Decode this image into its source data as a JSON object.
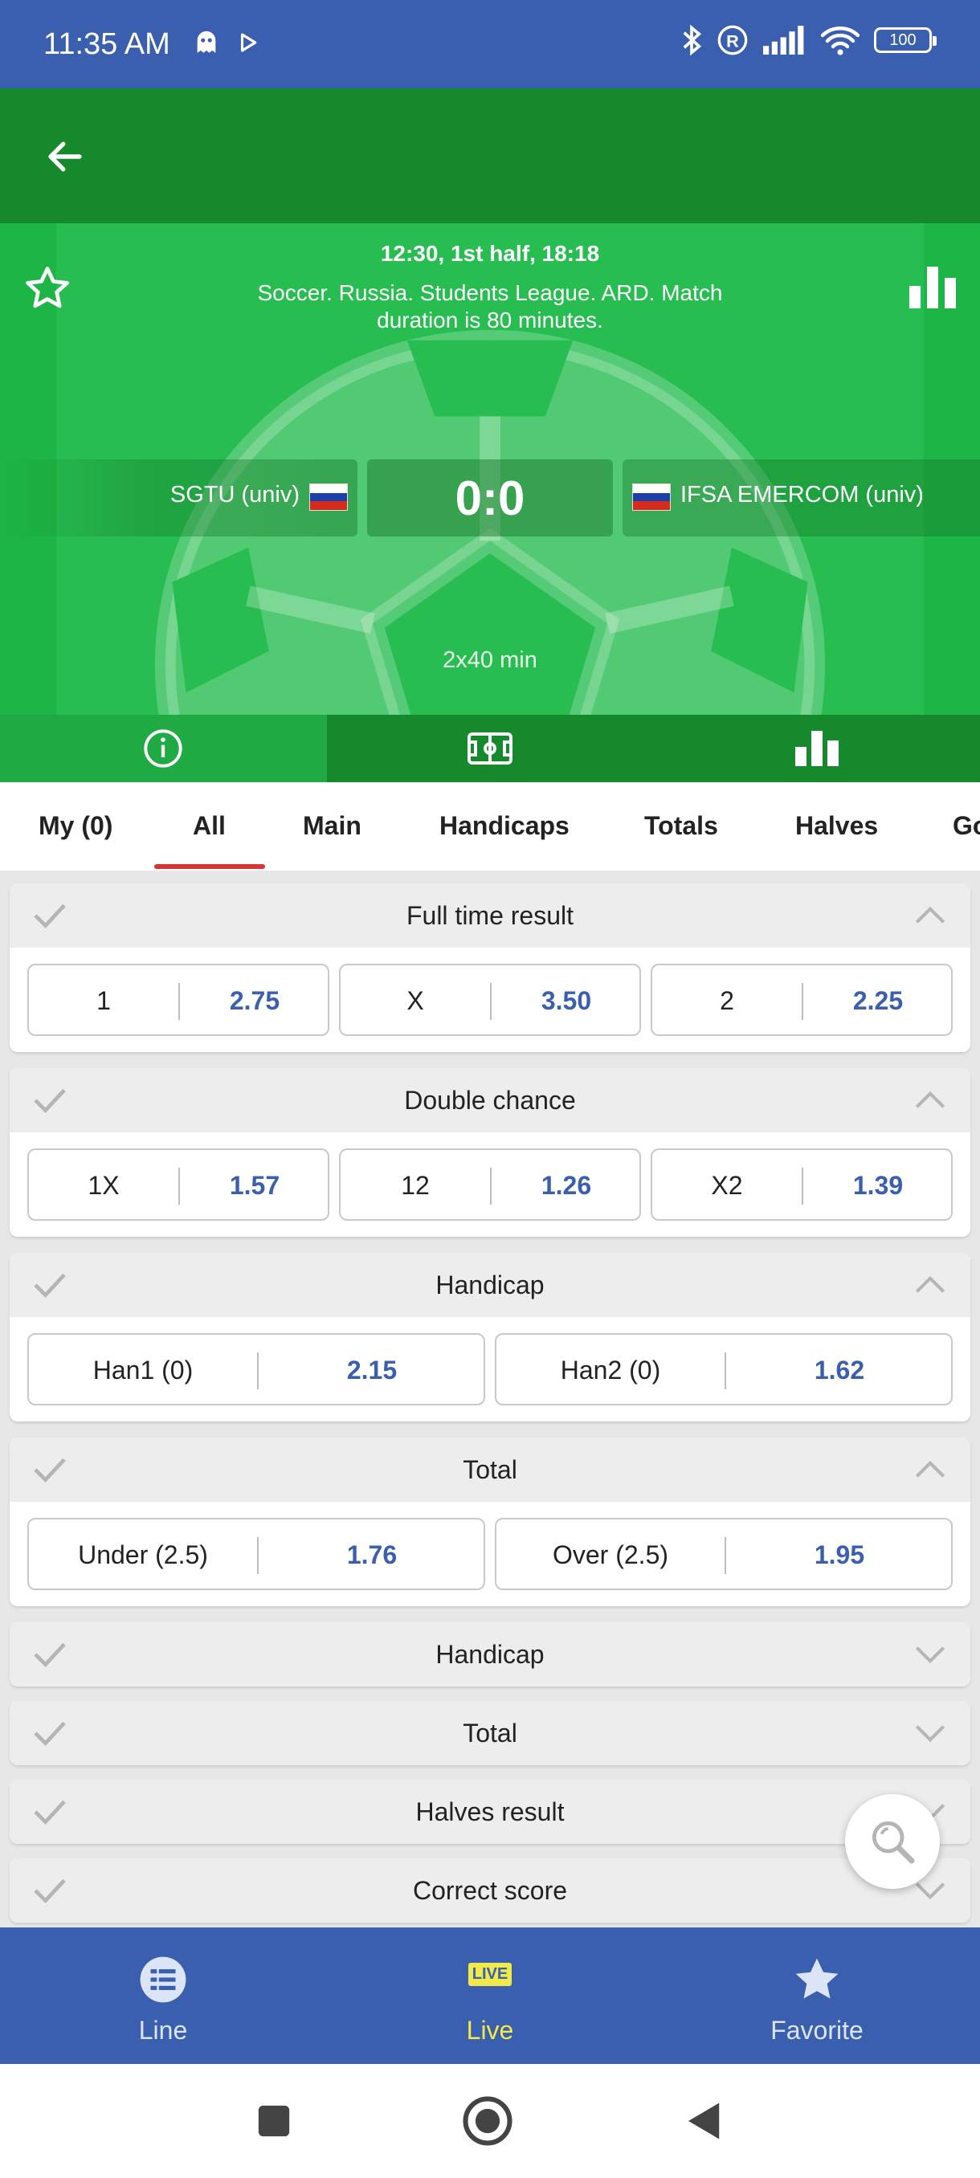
{
  "status_bar": {
    "time": "11:35 AM",
    "battery": "100",
    "icons": [
      "ghost-icon",
      "play-icon",
      "bluetooth-icon",
      "registered-icon",
      "signal-icon",
      "wifi-icon",
      "battery-icon"
    ]
  },
  "match": {
    "time_info": "12:30, 1st half, 18:18",
    "league": "Soccer. Russia. Students League. ARD. Match duration is 80 minutes.",
    "team1": "SGTU (univ)",
    "team2": "IFSA EMERCOM (univ)",
    "score": "0:0",
    "duration": "2x40 min",
    "team1_flag": [
      "#ffffff",
      "#1c3fa8",
      "#d52b1e"
    ],
    "team2_flag": [
      "#ffffff",
      "#1c3fa8",
      "#d52b1e"
    ]
  },
  "header_tabs": [
    "info-icon",
    "field-icon",
    "stats-icon"
  ],
  "market_tabs": [
    "My (0)",
    "All",
    "Main",
    "Handicaps",
    "Totals",
    "Halves",
    "Go"
  ],
  "markets": [
    {
      "title": "Full time result",
      "expanded": true,
      "odds": [
        {
          "label": "1",
          "value": "2.75"
        },
        {
          "label": "X",
          "value": "3.50"
        },
        {
          "label": "2",
          "value": "2.25"
        }
      ]
    },
    {
      "title": "Double chance",
      "expanded": true,
      "odds": [
        {
          "label": "1X",
          "value": "1.57"
        },
        {
          "label": "12",
          "value": "1.26"
        },
        {
          "label": "X2",
          "value": "1.39"
        }
      ]
    },
    {
      "title": "Handicap",
      "expanded": true,
      "odds": [
        {
          "label": "Han1 (0)",
          "value": "2.15"
        },
        {
          "label": "Han2 (0)",
          "value": "1.62"
        }
      ]
    },
    {
      "title": "Total",
      "expanded": true,
      "odds": [
        {
          "label": "Under (2.5)",
          "value": "1.76"
        },
        {
          "label": "Over (2.5)",
          "value": "1.95"
        }
      ]
    },
    {
      "title": "Handicap",
      "expanded": false,
      "odds": []
    },
    {
      "title": "Total",
      "expanded": false,
      "odds": []
    },
    {
      "title": "Halves result",
      "expanded": false,
      "odds": []
    },
    {
      "title": "Correct score",
      "expanded": false,
      "odds": []
    }
  ],
  "bottom_nav": [
    {
      "label": "Line",
      "icon": "list-icon"
    },
    {
      "label": "Live",
      "icon": "live-icon",
      "badge": "LIVE"
    },
    {
      "label": "Favorite",
      "icon": "star-icon"
    }
  ],
  "colors": {
    "brand_blue": "#3a5fae",
    "header_green": "#15892c",
    "field_green": "#27bd51",
    "odds_blue": "#3a5fae",
    "live_yellow": "#f2e94a",
    "tab_underline": "#d73434"
  }
}
